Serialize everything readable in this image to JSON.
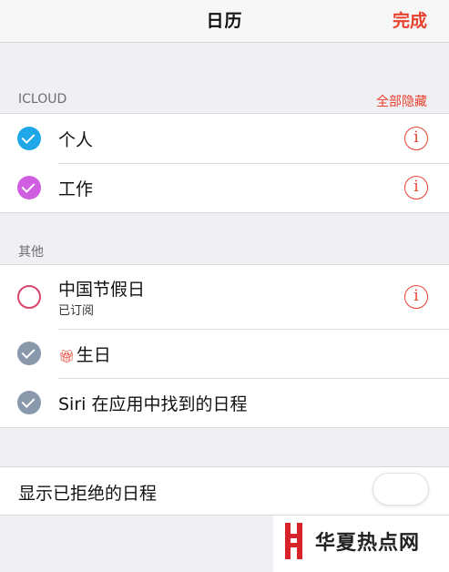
{
  "nav": {
    "title": "日历",
    "done_label": "完成"
  },
  "icloud": {
    "header": "ICLOUD",
    "hide_all_label": "全部隐藏",
    "items": [
      {
        "label": "个人",
        "color": "#1fa7e8",
        "checked": true
      },
      {
        "label": "工作",
        "color": "#cf5fe0",
        "checked": true
      }
    ]
  },
  "other": {
    "header": "其他",
    "items": [
      {
        "label": "中国节假日",
        "sublabel": "已订阅",
        "color": "#d9456a",
        "checked": false
      },
      {
        "label": "生日",
        "icon": "gift-icon",
        "color": "#8a98ab",
        "checked": true
      },
      {
        "label": "Siri 在应用中找到的日程",
        "color": "#8a98ab",
        "checked": true
      }
    ]
  },
  "declined": {
    "label": "显示已拒绝的日程",
    "toggle_on": false
  },
  "watermark": {
    "text": "华夏热点网",
    "brand_color": "#d8232a"
  }
}
